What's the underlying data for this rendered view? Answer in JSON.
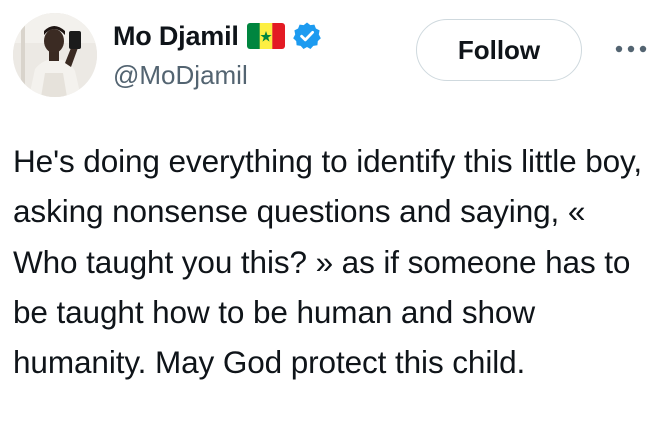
{
  "author": {
    "display_name": "Mo Djamil",
    "handle": "@MoDjamil",
    "flag": "senegal-flag-icon",
    "verified": true,
    "verified_color": "#1d9bf0"
  },
  "actions": {
    "follow_label": "Follow",
    "more_icon": "more-horizontal-icon"
  },
  "tweet": {
    "text": "He's doing everything to identify this little boy, asking nonsense questions and saying, « Who taught you this? » as if someone has to be taught how to be human and show humanity. May God protect this child."
  },
  "colors": {
    "text_primary": "#0f1419",
    "text_secondary": "#536471",
    "border": "#cfd9de"
  }
}
